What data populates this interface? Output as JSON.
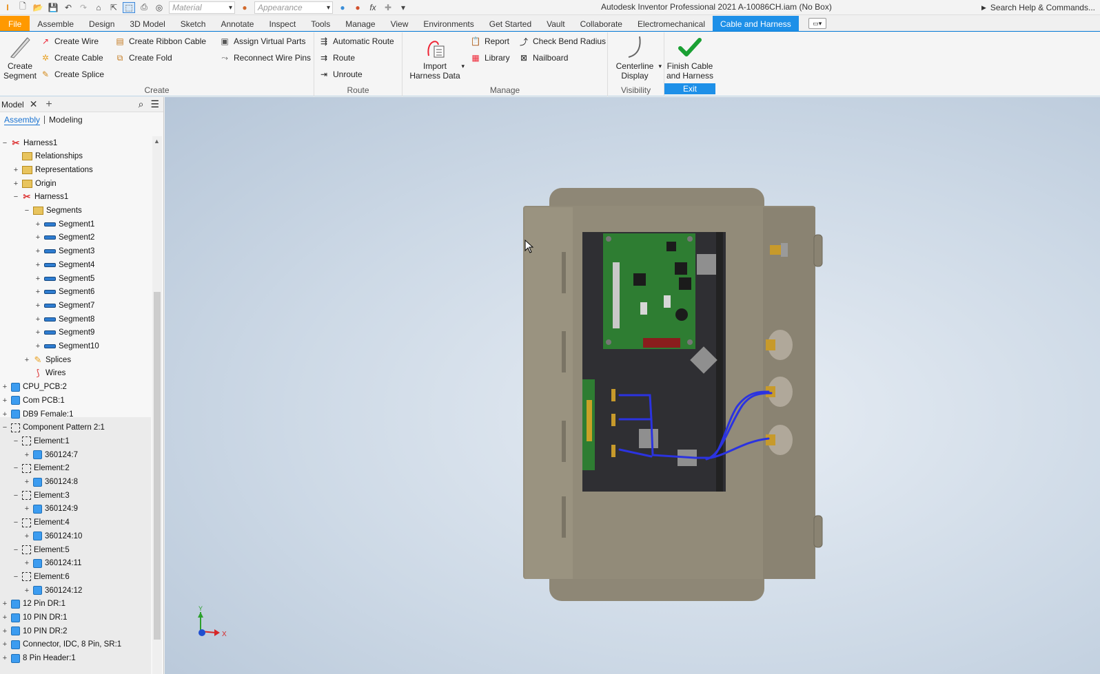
{
  "app": {
    "title": "Autodesk Inventor Professional 2021  A-10086CH.iam (No Box)",
    "material_placeholder": "Material",
    "appearance_placeholder": "Appearance",
    "help_search": "Search Help & Commands..."
  },
  "tabs": [
    "File",
    "Assemble",
    "Design",
    "3D Model",
    "Sketch",
    "Annotate",
    "Inspect",
    "Tools",
    "Manage",
    "View",
    "Environments",
    "Get Started",
    "Vault",
    "Collaborate",
    "Electromechanical",
    "Cable and Harness"
  ],
  "active_tab": "Cable and Harness",
  "ribbon": {
    "create": {
      "title": "Create",
      "create_segment": "Create\nSegment",
      "create_wire": "Create Wire",
      "create_cable": "Create Cable",
      "create_splice": "Create Splice",
      "create_ribbon_cable": "Create Ribbon Cable",
      "create_fold": "Create Fold",
      "assign_virtual_parts": "Assign Virtual Parts",
      "reconnect_wire_pins": "Reconnect Wire Pins"
    },
    "route": {
      "title": "Route",
      "automatic_route": "Automatic Route",
      "route": "Route",
      "unroute": "Unroute"
    },
    "manage": {
      "title": "Manage",
      "import_harness_data": "Import\nHarness Data",
      "report": "Report",
      "library": "Library",
      "check_bend_radius": "Check Bend Radius",
      "nailboard": "Nailboard"
    },
    "visibility": {
      "title": "Visibility",
      "centerline_display": "Centerline\nDisplay"
    },
    "exit": {
      "title": "Exit",
      "finish": "Finish Cable\nand Harness"
    }
  },
  "browser": {
    "title": "Model",
    "tab_assembly": "Assembly",
    "tab_modeling": "Modeling",
    "tree": [
      {
        "label": "Harness1",
        "toggle": "−",
        "icon": "harness",
        "indent": 0
      },
      {
        "label": "Relationships",
        "toggle": "",
        "icon": "folder",
        "indent": 1
      },
      {
        "label": "Representations",
        "toggle": "+",
        "icon": "folder",
        "indent": 1
      },
      {
        "label": "Origin",
        "toggle": "+",
        "icon": "folder",
        "indent": 1
      },
      {
        "label": "Harness1",
        "toggle": "−",
        "icon": "harness",
        "indent": 1
      },
      {
        "label": "Segments",
        "toggle": "−",
        "icon": "folder",
        "indent": 2
      },
      {
        "label": "Segment1",
        "toggle": "+",
        "icon": "seg",
        "indent": 3
      },
      {
        "label": "Segment2",
        "toggle": "+",
        "icon": "seg",
        "indent": 3
      },
      {
        "label": "Segment3",
        "toggle": "+",
        "icon": "seg",
        "indent": 3
      },
      {
        "label": "Segment4",
        "toggle": "+",
        "icon": "seg",
        "indent": 3
      },
      {
        "label": "Segment5",
        "toggle": "+",
        "icon": "seg",
        "indent": 3
      },
      {
        "label": "Segment6",
        "toggle": "+",
        "icon": "seg",
        "indent": 3
      },
      {
        "label": "Segment7",
        "toggle": "+",
        "icon": "seg",
        "indent": 3
      },
      {
        "label": "Segment8",
        "toggle": "+",
        "icon": "seg",
        "indent": 3
      },
      {
        "label": "Segment9",
        "toggle": "+",
        "icon": "seg",
        "indent": 3
      },
      {
        "label": "Segment10",
        "toggle": "+",
        "icon": "seg",
        "indent": 3
      },
      {
        "label": "Splices",
        "toggle": "+",
        "icon": "splice",
        "indent": 2
      },
      {
        "label": "Wires",
        "toggle": "",
        "icon": "wire",
        "indent": 2
      },
      {
        "label": "CPU_PCB:2",
        "toggle": "+",
        "icon": "part",
        "indent": 0
      },
      {
        "label": "Com PCB:1",
        "toggle": "+",
        "icon": "part",
        "indent": 0
      },
      {
        "label": "DB9 Female:1",
        "toggle": "+",
        "icon": "part",
        "indent": 0
      },
      {
        "label": "Component Pattern 2:1",
        "toggle": "−",
        "icon": "pattern",
        "indent": 0
      },
      {
        "label": "Element:1",
        "toggle": "−",
        "icon": "pattern",
        "indent": 1
      },
      {
        "label": "360124:7",
        "toggle": "+",
        "icon": "part",
        "indent": 2
      },
      {
        "label": "Element:2",
        "toggle": "−",
        "icon": "pattern",
        "indent": 1
      },
      {
        "label": "360124:8",
        "toggle": "+",
        "icon": "part",
        "indent": 2
      },
      {
        "label": "Element:3",
        "toggle": "−",
        "icon": "pattern",
        "indent": 1
      },
      {
        "label": "360124:9",
        "toggle": "+",
        "icon": "part",
        "indent": 2
      },
      {
        "label": "Element:4",
        "toggle": "−",
        "icon": "pattern",
        "indent": 1
      },
      {
        "label": "360124:10",
        "toggle": "+",
        "icon": "part",
        "indent": 2
      },
      {
        "label": "Element:5",
        "toggle": "−",
        "icon": "pattern",
        "indent": 1
      },
      {
        "label": "360124:11",
        "toggle": "+",
        "icon": "part",
        "indent": 2
      },
      {
        "label": "Element:6",
        "toggle": "−",
        "icon": "pattern",
        "indent": 1
      },
      {
        "label": "360124:12",
        "toggle": "+",
        "icon": "part",
        "indent": 2
      },
      {
        "label": "12 Pin DR:1",
        "toggle": "+",
        "icon": "part",
        "indent": 0
      },
      {
        "label": "10 PIN DR:1",
        "toggle": "+",
        "icon": "part",
        "indent": 0
      },
      {
        "label": "10 PIN DR:2",
        "toggle": "+",
        "icon": "part",
        "indent": 0
      },
      {
        "label": "Connector, IDC, 8 Pin, SR:1",
        "toggle": "+",
        "icon": "part",
        "indent": 0
      },
      {
        "label": "8 Pin Header:1",
        "toggle": "+",
        "icon": "part",
        "indent": 0
      }
    ]
  },
  "viewport": {
    "triad_x": "X",
    "triad_y": "Y",
    "wire_color": "#2b33e0",
    "enclosure_color": "#8d8775",
    "pcb_color": "#2e7d32"
  }
}
